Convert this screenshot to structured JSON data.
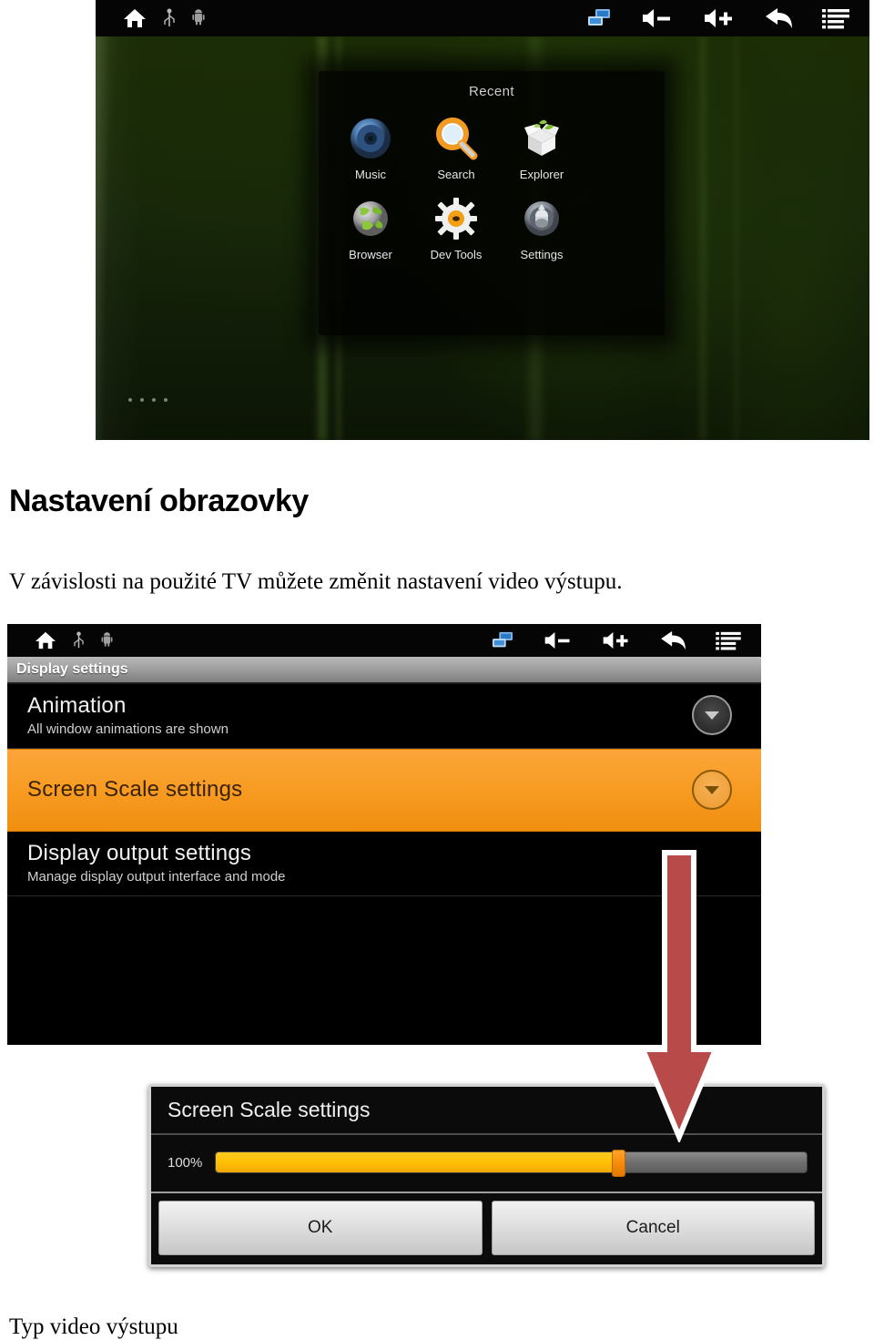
{
  "document": {
    "heading": "Nastavení obrazovky",
    "paragraph": "V závislosti na použité TV můžete změnit nastavení video výstupu.",
    "footer": "Typ video výstupu"
  },
  "colors": {
    "accent_orange": "#f79b22",
    "slider_yellow": "#ffc107",
    "arrow_red": "#b94a4a",
    "wallpaper_green": "#16250a"
  },
  "statusbar": {
    "left_icons": [
      {
        "name": "home-icon",
        "label": "Home"
      },
      {
        "name": "usb-icon",
        "label": "USB"
      },
      {
        "name": "android-icon",
        "label": "Android"
      }
    ],
    "right_icons": [
      {
        "name": "network-icon",
        "label": "Network"
      },
      {
        "name": "volume-down-icon",
        "label": "Volume down"
      },
      {
        "name": "volume-up-icon",
        "label": "Volume up"
      },
      {
        "name": "back-icon",
        "label": "Back"
      },
      {
        "name": "menu-icon",
        "label": "Menu"
      }
    ]
  },
  "home_screen": {
    "recent_panel": {
      "title": "Recent",
      "apps": [
        {
          "label": "Music",
          "icon": "music-icon"
        },
        {
          "label": "Search",
          "icon": "search-icon"
        },
        {
          "label": "Explorer",
          "icon": "explorer-icon"
        },
        {
          "label": "Browser",
          "icon": "browser-icon"
        },
        {
          "label": "Dev Tools",
          "icon": "dev-tools-icon"
        },
        {
          "label": "Settings",
          "icon": "settings-icon"
        }
      ]
    },
    "page_indicator_dots": 4
  },
  "settings_screen": {
    "title": "Display settings",
    "rows": [
      {
        "title": "Animation",
        "subtitle": "All window animations are shown",
        "selected": false,
        "has_chevron": true
      },
      {
        "title": "Screen Scale settings",
        "subtitle": "",
        "selected": true,
        "has_chevron": true
      },
      {
        "title": "Display output settings",
        "subtitle": "Manage display output interface and mode",
        "selected": false,
        "has_chevron": false
      }
    ]
  },
  "dialog": {
    "title": "Screen Scale settings",
    "percent_label": "100%",
    "slider_value": 68,
    "ok_label": "OK",
    "cancel_label": "Cancel"
  },
  "annotation": {
    "arrow_direction": "down"
  }
}
